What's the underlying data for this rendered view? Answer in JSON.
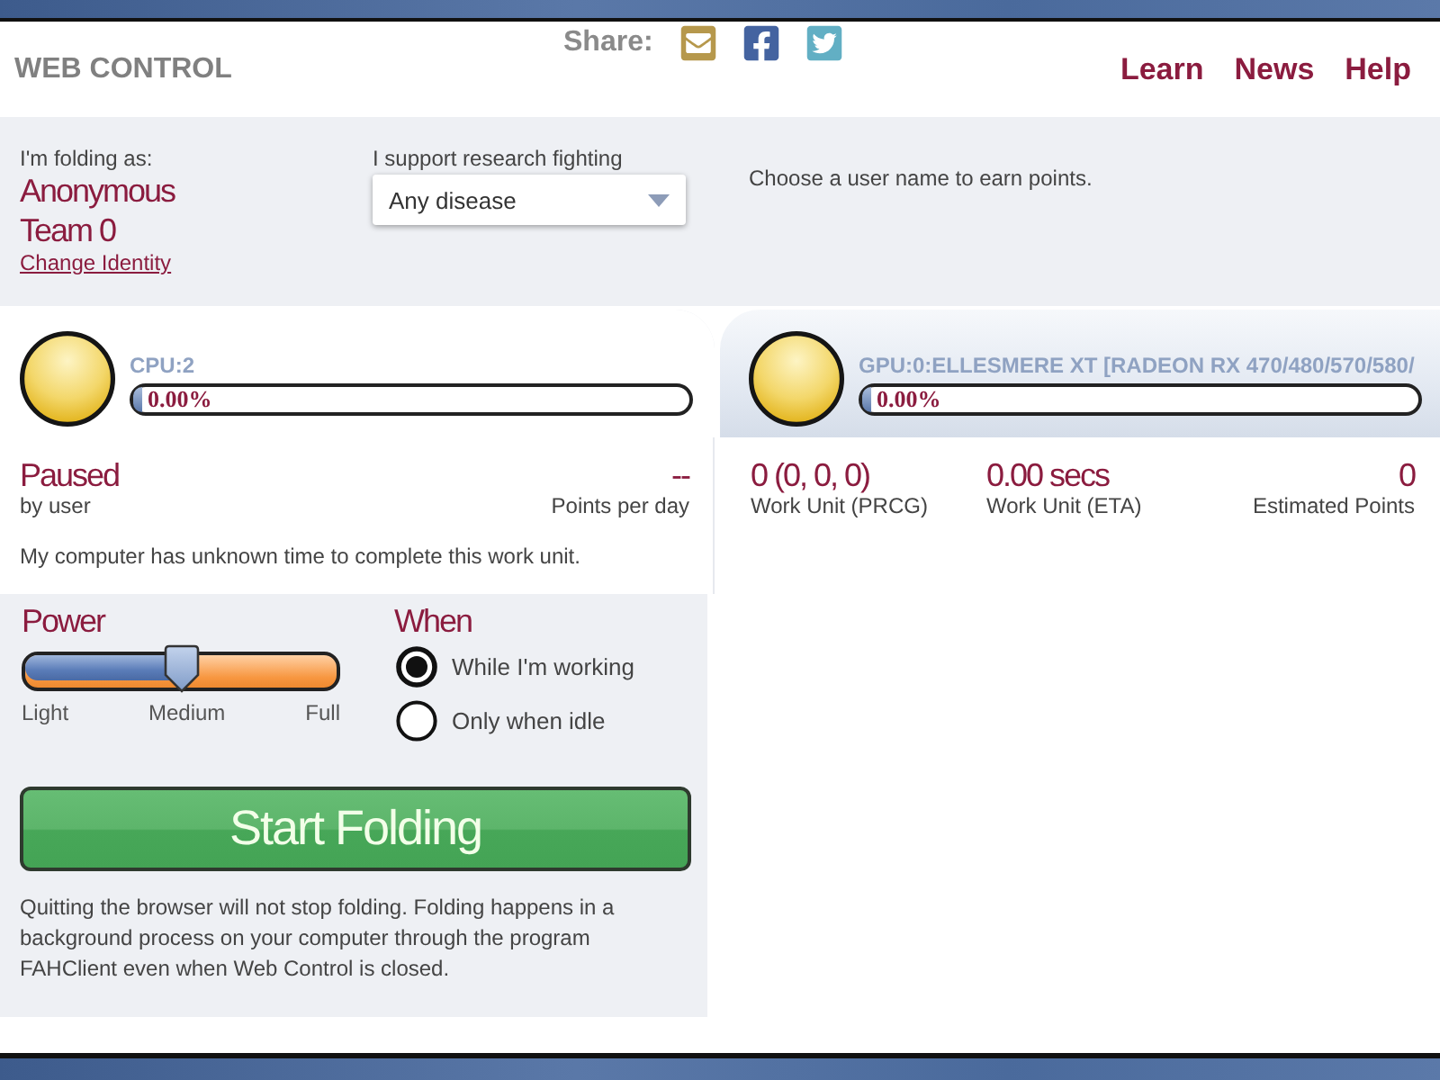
{
  "header": {
    "title": "WEB CONTROL",
    "share_label": "Share:",
    "nav": [
      "Learn",
      "News",
      "Help"
    ]
  },
  "identity": {
    "label": "I'm folding as:",
    "name": "Anonymous",
    "team": "Team 0",
    "link": "Change Identity"
  },
  "cause": {
    "label": "I support research fighting",
    "value": "Any disease"
  },
  "points_note": "Choose a user name to earn points.",
  "slots": [
    {
      "title": "CPU:2",
      "progress": "0.00%",
      "level": 0,
      "selected": true,
      "stats": [
        {
          "value": "Paused",
          "label": "by user"
        },
        {
          "value": "--",
          "label": "Points per day"
        }
      ],
      "note": "My computer has unknown time to complete this work unit."
    },
    {
      "title": "GPU:0:ELLESMERE XT [RADEON RX 470/480/570/580/",
      "progress": "0.00%",
      "level": 0,
      "selected": false,
      "stats": [
        {
          "value": "0 (0, 0, 0)",
          "label": "Work Unit (PRCG)"
        },
        {
          "value": "0.00 secs",
          "label": "Work Unit (ETA)"
        },
        {
          "value": "0",
          "label": "Estimated Points"
        }
      ]
    }
  ],
  "power": {
    "label": "Power",
    "level": 0.5,
    "marks": [
      "Light",
      "Medium",
      "Full"
    ]
  },
  "when": {
    "label": "When",
    "options": [
      {
        "label": "While I'm working",
        "selected": true
      },
      {
        "label": "Only when idle",
        "selected": false
      }
    ]
  },
  "start_button": "Start Folding",
  "footer_note": "Quitting the browser will not stop folding. Folding happens in a background process on your computer through the program FAHClient even when Web Control is closed."
}
